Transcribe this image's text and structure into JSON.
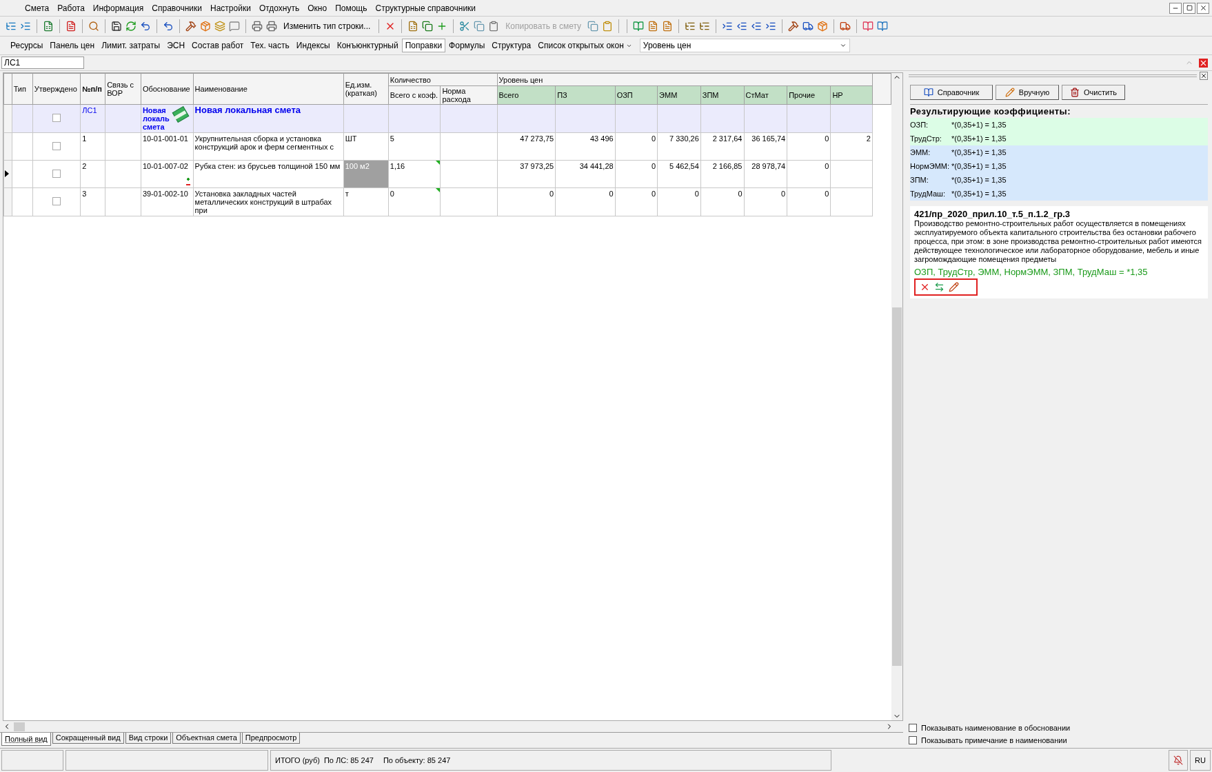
{
  "menu": [
    "Смета",
    "Работа",
    "Информация",
    "Справочники",
    "Настройки",
    "Отдохнуть",
    "Окно",
    "Помощь",
    "Структурные справочники"
  ],
  "toolbar": {
    "change_row_type": {
      "label": "Изменить тип строки...",
      "disabled": false
    },
    "copy_to_estimate": {
      "label": "Копировать в смету",
      "disabled": true
    }
  },
  "nav_tabs": [
    {
      "label": "Ресурсы",
      "selected": false
    },
    {
      "label": "Панель цен",
      "selected": false
    },
    {
      "label": "Лимит. затраты",
      "selected": false
    },
    {
      "label": "ЭСН",
      "selected": false
    },
    {
      "label": "Состав работ",
      "selected": false
    },
    {
      "label": "Тех. часть",
      "selected": false
    },
    {
      "label": "Индексы",
      "selected": false
    },
    {
      "label": "Конъюнктурный",
      "selected": false
    },
    {
      "label": "Поправки",
      "selected": true
    },
    {
      "label": "Формулы",
      "selected": false
    },
    {
      "label": "Структура",
      "selected": false
    },
    {
      "label": "Список открытых окон",
      "selected": false,
      "dropdown": true
    }
  ],
  "price_level_select": {
    "value": "Уровень цен"
  },
  "document_field": {
    "value": "ЛС1"
  },
  "table": {
    "columns": [
      {
        "label": "Тип"
      },
      {
        "label": "Утверждено"
      },
      {
        "label": "№п/п",
        "bold": true
      },
      {
        "label": "Связь с ВОР"
      },
      {
        "label": "Обоснование"
      },
      {
        "label": "Наименование"
      },
      {
        "label": "Ед.изм. (краткая)"
      },
      {
        "label": "Количество",
        "children": [
          {
            "label": "Всего с коэф."
          },
          {
            "label": "Норма расхода"
          }
        ]
      },
      {
        "label": "Уровень цен",
        "kind": "price",
        "children": [
          {
            "label": "Всего"
          },
          {
            "label": "ПЗ"
          },
          {
            "label": "ОЗП"
          },
          {
            "label": "ЭММ"
          },
          {
            "label": "ЗПМ"
          },
          {
            "label": "СтМат"
          },
          {
            "label": "Прочие"
          },
          {
            "label": "НР"
          }
        ]
      }
    ],
    "rows": [
      {
        "kind": "estimate",
        "current": false,
        "approved": false,
        "number": "ЛС1",
        "basis": "Новая локаль смета",
        "name": "Новая локальная смета"
      },
      {
        "kind": "item",
        "current": false,
        "approved": false,
        "number": "1",
        "basis": "10-01-001-01",
        "adjusted": false,
        "name": "Укрупнительная сборка и установка конструкций арок и ферм сегментных с",
        "unit": "ШТ",
        "unit_selected": false,
        "quantity": "5",
        "quantity_flag": false,
        "values": [
          "47 273,75",
          "43 496",
          "0",
          "7 330,26",
          "2 317,64",
          "36 165,74",
          "0",
          "2"
        ]
      },
      {
        "kind": "item",
        "current": true,
        "approved": false,
        "number": "2",
        "basis": "10-01-007-02",
        "adjusted": true,
        "name": "Рубка стен: из брусьев толщиной 150 мм",
        "unit": "100 м2",
        "unit_selected": true,
        "quantity": "1,16",
        "quantity_flag": true,
        "values": [
          "37 973,25",
          "34 441,28",
          "0",
          "5 462,54",
          "2 166,85",
          "28 978,74",
          "0"
        ]
      },
      {
        "kind": "item",
        "current": false,
        "approved": false,
        "number": "3",
        "basis": "39-01-002-10",
        "adjusted": false,
        "name": "Установка закладных частей металлических конструкций в штрабах при",
        "unit": "т",
        "unit_selected": false,
        "quantity": "0",
        "quantity_flag": true,
        "values": [
          "0",
          "0",
          "0",
          "0",
          "0",
          "0",
          "0"
        ]
      }
    ]
  },
  "view_tabs": [
    {
      "label": "Полный вид",
      "selected": true
    },
    {
      "label": "Сокращенный вид",
      "selected": false
    },
    {
      "label": "Вид строки",
      "selected": false
    },
    {
      "label": "Объектная смета",
      "selected": false
    },
    {
      "label": "Предпросмотр",
      "selected": false
    }
  ],
  "adjustments_panel": {
    "buttons": [
      {
        "kind": "reference",
        "label": "Справочник"
      },
      {
        "kind": "manual",
        "label": "Вручную"
      },
      {
        "kind": "clear",
        "label": "Очистить"
      }
    ],
    "coefficients_title": "Результирующие коэффициенты:",
    "coefficients": [
      {
        "name": "ОЗП:",
        "formula": "*(0,35+1) = 1,35",
        "color": "#dcfde6"
      },
      {
        "name": "ТрудСтр:",
        "formula": "*(0,35+1) = 1,35",
        "color": "#dcfde6"
      },
      {
        "name": "ЭММ:",
        "formula": "*(0,35+1) = 1,35",
        "color": "#d6e8fc"
      },
      {
        "name": "НормЭММ:",
        "formula": "*(0,35+1) = 1,35",
        "color": "#d6e8fc"
      },
      {
        "name": "ЗПМ:",
        "formula": "*(0,35+1) = 1,35",
        "color": "#d6e8fc"
      },
      {
        "name": "ТрудМаш:",
        "formula": "*(0,35+1) = 1,35",
        "color": "#d6e8fc"
      }
    ],
    "adjustment": {
      "code": "421/пр_2020_прил.10_т.5_п.1.2_гр.3",
      "description": "Производство ремонтно-строительных работ осуществляется в помещениях эксплуатируемого объекта капитального строительства без остановки рабочего процесса, при этом: в зоне производства ремонтно-строительных работ имеются действующее технологическое или лабораторное оборудование, мебель и иные загромождающие помещения предметы",
      "result": "ОЗП, ТрудСтр, ЭММ, НормЭММ, ЗПМ, ТрудМаш = *1,35"
    },
    "options": [
      {
        "label": "Показывать наименование в обосновании",
        "checked": false
      },
      {
        "label": "Показывать примечание в наименовании",
        "checked": false
      }
    ]
  },
  "status_bar": {
    "total_label": "ИТОГО (руб)",
    "estimate_total": "По ЛС: 85 247",
    "object_total": "По объекту: 85 247",
    "language": "RU"
  }
}
